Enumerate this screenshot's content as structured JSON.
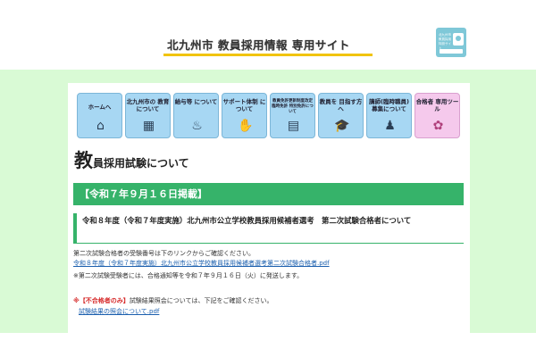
{
  "header": {
    "site_title": "北九州市 教員採用情報 専用サイト",
    "logo_text": "北九州市 教員採用 特設サイト",
    "logo_icon": "school-logo-icon",
    "accent_color": "#f1c40f"
  },
  "nav": {
    "items": [
      {
        "label": "ホームへ",
        "icon": "home-icon",
        "glyph": "⌂"
      },
      {
        "label": "北九州市の 教育について",
        "icon": "school-building-icon",
        "glyph": "▦"
      },
      {
        "label": "給与等 について",
        "icon": "money-hand-icon",
        "glyph": "♨"
      },
      {
        "label": "サポート体制 について",
        "icon": "handshake-icon",
        "glyph": "✋"
      },
      {
        "label": "教員免許更新制度改定 臨時免許 特別免許について",
        "icon": "id-card-icon",
        "glyph": "▤"
      },
      {
        "label": "教員を 目指す方へ",
        "icon": "graduation-cap-icon",
        "glyph": "🎓"
      },
      {
        "label": "講師(臨時職員) 募集について",
        "icon": "teacher-icon",
        "glyph": "♟"
      },
      {
        "label": "合格者 専用ツール",
        "icon": "sakura-icon",
        "glyph": "✿"
      }
    ]
  },
  "page": {
    "heading_big": "教",
    "heading_rest": "員採用試験について",
    "date_bar": "【令和７年９月１６日掲載】",
    "section_title": "令和８年度（令和７年度実施）北九州市公立学校教員採用候補者選考　第二次試験合格者について",
    "line1": "第二次試験合格者の受験番号は下のリンクからご確認ください。",
    "link1": "令和８年度（令和７年度実施）北九州市公立学校教員採用候補者選考第二次試験合格者.pdf",
    "line3": "※第二次試験受験者には、合格通知等を令和７年９月１６日（火）に発送します。",
    "line4_prefix": "※",
    "line4_red": "【不合格者のみ】",
    "line4_rest": "試験結果照会については、下記をご確認ください。",
    "link2": "試験結果の照会について.pdf",
    "green_color": "#36b36a",
    "band_color": "#d9fad5"
  }
}
